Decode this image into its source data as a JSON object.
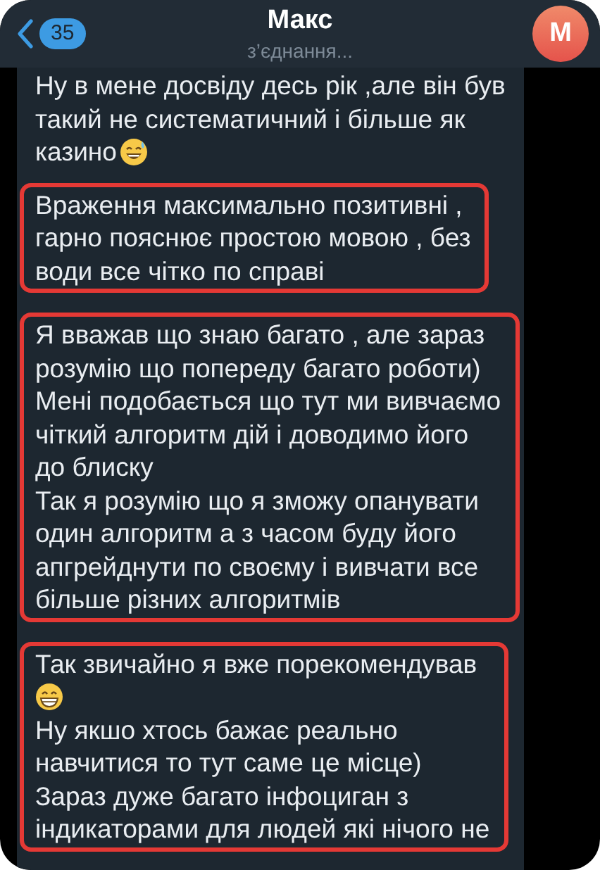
{
  "header": {
    "back_badge": "35",
    "title": "Макс",
    "subtitle": "з’єднання...",
    "avatar_letter": "М"
  },
  "messages": [
    {
      "highlighted": false,
      "lines": [
        {
          "text": "Ну в мене досвіду десь рік ,але він був"
        },
        {
          "text": "такий не систематичний і більше як"
        },
        {
          "kind": "sweatsmile",
          "text": "казино"
        }
      ]
    },
    {
      "highlighted": true,
      "lines": [
        {
          "text": "Враження максимально позитивні ,"
        },
        {
          "text": "гарно пояснює простою мовою , без"
        },
        {
          "text": "води все чітко по справі"
        }
      ]
    },
    {
      "highlighted": true,
      "lines": [
        {
          "text": "Я вважав що знаю багато , але зараз"
        },
        {
          "text": "розумію що попереду багато роботи)"
        },
        {
          "text": "Мені подобається що тут ми вивчаємо"
        },
        {
          "text": "чіткий алгоритм дій і доводимо його"
        },
        {
          "text": "до блиску"
        },
        {
          "text": "Так я розумію що я зможу опанувати"
        },
        {
          "text": "один алгоритм а з часом буду його"
        },
        {
          "text": "апгрейднути по своєму і вивчати все"
        },
        {
          "text": "більше різних алгоритмів"
        }
      ]
    },
    {
      "highlighted": true,
      "lines": [
        {
          "text": "Так звичайно я вже порекомендував"
        },
        {
          "kind": "grin"
        },
        {
          "text": "Ну якшо хтось бажає реально"
        },
        {
          "text": "навчитися то тут саме це місце)"
        },
        {
          "text": "Зараз дуже багато інфоциган з"
        },
        {
          "text": "індикаторами для людей які нічого не"
        }
      ]
    }
  ]
}
